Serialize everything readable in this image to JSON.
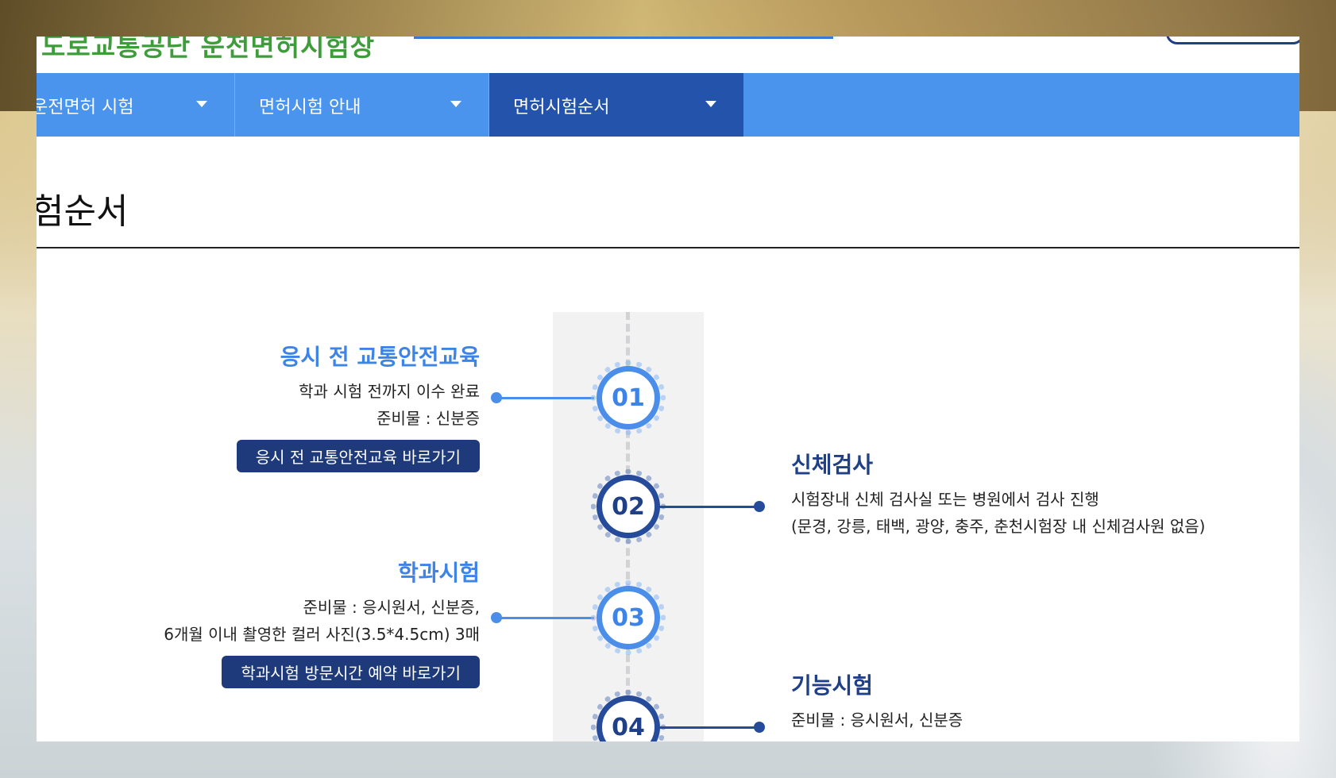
{
  "header": {
    "logo_text": "도로교통공단 운전면허시험장"
  },
  "nav": {
    "items": [
      {
        "label": "운전면허 시험"
      },
      {
        "label": "면허시험 안내"
      },
      {
        "label": "면허시험순서"
      }
    ]
  },
  "main": {
    "page_title": "험순서",
    "steps": [
      {
        "number": "01",
        "title": "응시 전 교통안전교육",
        "lines": [
          "학과 시험 전까지 이수 완료",
          "준비물 : 신분증"
        ],
        "button": "응시 전 교통안전교육 바로가기"
      },
      {
        "number": "02",
        "title": "신체검사",
        "lines": [
          "시험장내 신체 검사실 또는 병원에서 검사 진행",
          "(문경, 강릉, 태백, 광양, 충주, 춘천시험장 내 신체검사원 없음)"
        ]
      },
      {
        "number": "03",
        "title": "학과시험",
        "lines": [
          "준비물 : 응시원서, 신분증,",
          "6개월 이내 촬영한 컬러 사진(3.5*4.5cm) 3매"
        ],
        "button": "학과시험 방문시간 예약 바로가기"
      },
      {
        "number": "04",
        "title": "기능시험",
        "lines": [
          "준비물 : 응시원서, 신분증"
        ]
      }
    ]
  },
  "colors": {
    "nav_bg": "#4a94ee",
    "nav_active_bg": "#2453ac",
    "step_light": "#3d84e6",
    "step_dark": "#1f3f86",
    "button_bg": "#1e3a7a"
  }
}
